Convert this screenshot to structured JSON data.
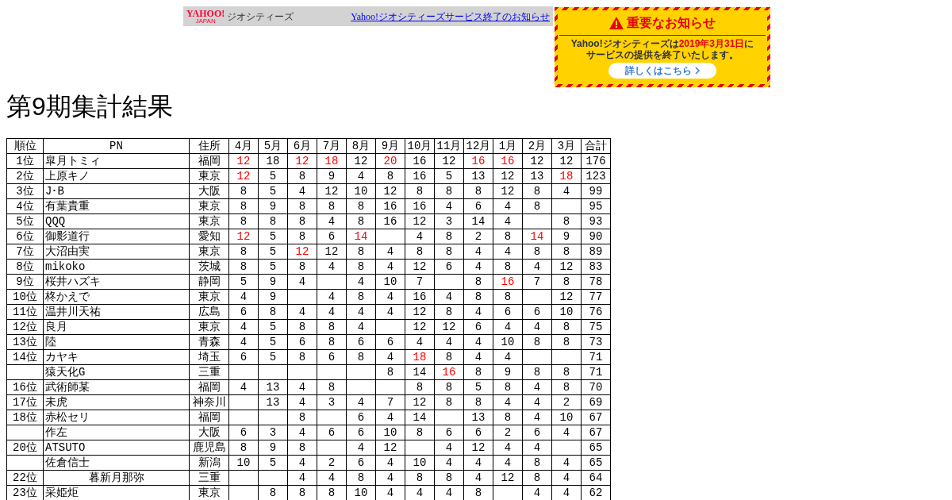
{
  "banner": {
    "logo": "YAHOO!",
    "logo_sub": "JAPAN",
    "service": "ジオシティーズ",
    "link": "Yahoo!ジオシティーズサービス終了のお知らせ"
  },
  "notice": {
    "title": "重要なお知らせ",
    "body_before": "Yahoo!ジオシティーズは",
    "date": "2019年3月31日",
    "body_after": "に",
    "line2": "サービスの提供を終了いたします。",
    "button": "詳しくはこちら"
  },
  "title": "第9期集計結果",
  "table": {
    "columns": [
      "順位",
      "PN",
      "住所",
      "4月",
      "5月",
      "6月",
      "7月",
      "8月",
      "9月",
      "10月",
      "11月",
      "12月",
      "1月",
      "2月",
      "3月",
      "合計"
    ],
    "rows": [
      {
        "rank": "1位",
        "name": "皐月トミィ",
        "centered": false,
        "place": "福岡",
        "months": {
          "apr": {
            "text": "12",
            "highlighted": true
          },
          "may": {
            "text": "18",
            "highlighted": false
          },
          "jun": {
            "text": "12",
            "highlighted": true
          },
          "jul": {
            "text": "18",
            "highlighted": true
          },
          "aug": {
            "text": "12",
            "highlighted": false
          },
          "sep": {
            "text": "20",
            "highlighted": true
          },
          "oct": {
            "text": "16",
            "highlighted": false
          },
          "nov": {
            "text": "12",
            "highlighted": false
          },
          "dec": {
            "text": "16",
            "highlighted": true
          },
          "jan": {
            "text": "16",
            "highlighted": true
          },
          "feb": {
            "text": "12",
            "highlighted": false
          },
          "mar": {
            "text": "12",
            "highlighted": false
          }
        },
        "total": "176"
      },
      {
        "rank": "2位",
        "name": "上原キノ",
        "centered": false,
        "place": "東京",
        "months": {
          "apr": {
            "text": "12",
            "highlighted": true
          },
          "may": {
            "text": "5",
            "highlighted": false
          },
          "jun": {
            "text": "8",
            "highlighted": false
          },
          "jul": {
            "text": "9",
            "highlighted": false
          },
          "aug": {
            "text": "4",
            "highlighted": false
          },
          "sep": {
            "text": "8",
            "highlighted": false
          },
          "oct": {
            "text": "16",
            "highlighted": false
          },
          "nov": {
            "text": "5",
            "highlighted": false
          },
          "dec": {
            "text": "13",
            "highlighted": false
          },
          "jan": {
            "text": "12",
            "highlighted": false
          },
          "feb": {
            "text": "13",
            "highlighted": false
          },
          "mar": {
            "text": "18",
            "highlighted": true
          }
        },
        "total": "123"
      },
      {
        "rank": "3位",
        "name": "J･B",
        "centered": false,
        "place": "大阪",
        "months": {
          "apr": {
            "text": "8",
            "highlighted": false
          },
          "may": {
            "text": "5",
            "highlighted": false
          },
          "jun": {
            "text": "4",
            "highlighted": false
          },
          "jul": {
            "text": "12",
            "highlighted": false
          },
          "aug": {
            "text": "10",
            "highlighted": false
          },
          "sep": {
            "text": "12",
            "highlighted": false
          },
          "oct": {
            "text": "8",
            "highlighted": false
          },
          "nov": {
            "text": "8",
            "highlighted": false
          },
          "dec": {
            "text": "8",
            "highlighted": false
          },
          "jan": {
            "text": "12",
            "highlighted": false
          },
          "feb": {
            "text": "8",
            "highlighted": false
          },
          "mar": {
            "text": "4",
            "highlighted": false
          }
        },
        "total": "99"
      },
      {
        "rank": "4位",
        "name": "有葉貴重",
        "centered": false,
        "place": "東京",
        "months": {
          "apr": {
            "text": "8",
            "highlighted": false
          },
          "may": {
            "text": "9",
            "highlighted": false
          },
          "jun": {
            "text": "8",
            "highlighted": false
          },
          "jul": {
            "text": "8",
            "highlighted": false
          },
          "aug": {
            "text": "8",
            "highlighted": false
          },
          "sep": {
            "text": "16",
            "highlighted": false
          },
          "oct": {
            "text": "16",
            "highlighted": false
          },
          "nov": {
            "text": "4",
            "highlighted": false
          },
          "dec": {
            "text": "6",
            "highlighted": false
          },
          "jan": {
            "text": "4",
            "highlighted": false
          },
          "feb": {
            "text": "8",
            "highlighted": false
          }
        },
        "total": "95"
      },
      {
        "rank": "5位",
        "name": "QQQ",
        "centered": false,
        "place": "東京",
        "months": {
          "apr": {
            "text": "8",
            "highlighted": false
          },
          "may": {
            "text": "8",
            "highlighted": false
          },
          "jun": {
            "text": "8",
            "highlighted": false
          },
          "jul": {
            "text": "4",
            "highlighted": false
          },
          "aug": {
            "text": "8",
            "highlighted": false
          },
          "sep": {
            "text": "16",
            "highlighted": false
          },
          "oct": {
            "text": "12",
            "highlighted": false
          },
          "nov": {
            "text": "3",
            "highlighted": false
          },
          "dec": {
            "text": "14",
            "highlighted": false
          },
          "jan": {
            "text": "4",
            "highlighted": false
          },
          "mar": {
            "text": "8",
            "highlighted": false
          }
        },
        "total": "93"
      },
      {
        "rank": "6位",
        "name": "御影道行",
        "centered": false,
        "place": "愛知",
        "months": {
          "apr": {
            "text": "12",
            "highlighted": true
          },
          "may": {
            "text": "5",
            "highlighted": false
          },
          "jun": {
            "text": "8",
            "highlighted": false
          },
          "jul": {
            "text": "6",
            "highlighted": false
          },
          "aug": {
            "text": "14",
            "highlighted": true
          },
          "oct": {
            "text": "4",
            "highlighted": false
          },
          "nov": {
            "text": "8",
            "highlighted": false
          },
          "dec": {
            "text": "2",
            "highlighted": false
          },
          "jan": {
            "text": "8",
            "highlighted": false
          },
          "feb": {
            "text": "14",
            "highlighted": true
          },
          "mar": {
            "text": "9",
            "highlighted": false
          }
        },
        "total": "90"
      },
      {
        "rank": "7位",
        "name": "大沼由実",
        "centered": false,
        "place": "東京",
        "months": {
          "apr": {
            "text": "8",
            "highlighted": false
          },
          "may": {
            "text": "5",
            "highlighted": false
          },
          "jun": {
            "text": "12",
            "highlighted": true
          },
          "jul": {
            "text": "12",
            "highlighted": false
          },
          "aug": {
            "text": "8",
            "highlighted": false
          },
          "sep": {
            "text": "4",
            "highlighted": false
          },
          "oct": {
            "text": "8",
            "highlighted": false
          },
          "nov": {
            "text": "8",
            "highlighted": false
          },
          "dec": {
            "text": "4",
            "highlighted": false
          },
          "jan": {
            "text": "4",
            "highlighted": false
          },
          "feb": {
            "text": "8",
            "highlighted": false
          },
          "mar": {
            "text": "8",
            "highlighted": false
          }
        },
        "total": "89"
      },
      {
        "rank": "8位",
        "name": "mikoko",
        "centered": false,
        "place": "茨城",
        "months": {
          "apr": {
            "text": "8",
            "highlighted": false
          },
          "may": {
            "text": "5",
            "highlighted": false
          },
          "jun": {
            "text": "8",
            "highlighted": false
          },
          "jul": {
            "text": "4",
            "highlighted": false
          },
          "aug": {
            "text": "8",
            "highlighted": false
          },
          "sep": {
            "text": "4",
            "highlighted": false
          },
          "oct": {
            "text": "12",
            "highlighted": false
          },
          "nov": {
            "text": "6",
            "highlighted": false
          },
          "dec": {
            "text": "4",
            "highlighted": false
          },
          "jan": {
            "text": "8",
            "highlighted": false
          },
          "feb": {
            "text": "4",
            "highlighted": false
          },
          "mar": {
            "text": "12",
            "highlighted": false
          }
        },
        "total": "83"
      },
      {
        "rank": "9位",
        "name": "桜井ハズキ",
        "centered": false,
        "place": "静岡",
        "months": {
          "apr": {
            "text": "5",
            "highlighted": false
          },
          "may": {
            "text": "9",
            "highlighted": false
          },
          "jun": {
            "text": "4",
            "highlighted": false
          },
          "aug": {
            "text": "4",
            "highlighted": false
          },
          "sep": {
            "text": "10",
            "highlighted": false
          },
          "oct": {
            "text": "7",
            "highlighted": false
          },
          "dec": {
            "text": "8",
            "highlighted": false
          },
          "jan": {
            "text": "16",
            "highlighted": true
          },
          "feb": {
            "text": "7",
            "highlighted": false
          },
          "mar": {
            "text": "8",
            "highlighted": false
          }
        },
        "total": "78"
      },
      {
        "rank": "10位",
        "name": "柊かえで",
        "centered": false,
        "place": "東京",
        "months": {
          "apr": {
            "text": "4",
            "highlighted": false
          },
          "may": {
            "text": "9",
            "highlighted": false
          },
          "jul": {
            "text": "4",
            "highlighted": false
          },
          "aug": {
            "text": "8",
            "highlighted": false
          },
          "sep": {
            "text": "4",
            "highlighted": false
          },
          "oct": {
            "text": "16",
            "highlighted": false
          },
          "nov": {
            "text": "4",
            "highlighted": false
          },
          "dec": {
            "text": "8",
            "highlighted": false
          },
          "jan": {
            "text": "8",
            "highlighted": false
          },
          "mar": {
            "text": "12",
            "highlighted": false
          }
        },
        "total": "77"
      },
      {
        "rank": "11位",
        "name": "温井川天祐",
        "centered": false,
        "place": "広島",
        "months": {
          "apr": {
            "text": "6",
            "highlighted": false
          },
          "may": {
            "text": "8",
            "highlighted": false
          },
          "jun": {
            "text": "4",
            "highlighted": false
          },
          "jul": {
            "text": "4",
            "highlighted": false
          },
          "aug": {
            "text": "4",
            "highlighted": false
          },
          "sep": {
            "text": "4",
            "highlighted": false
          },
          "oct": {
            "text": "12",
            "highlighted": false
          },
          "nov": {
            "text": "8",
            "highlighted": false
          },
          "dec": {
            "text": "4",
            "highlighted": false
          },
          "jan": {
            "text": "6",
            "highlighted": false
          },
          "feb": {
            "text": "6",
            "highlighted": false
          },
          "mar": {
            "text": "10",
            "highlighted": false
          }
        },
        "total": "76"
      },
      {
        "rank": "12位",
        "name": "良月",
        "centered": false,
        "place": "東京",
        "months": {
          "apr": {
            "text": "4",
            "highlighted": false
          },
          "may": {
            "text": "5",
            "highlighted": false
          },
          "jun": {
            "text": "8",
            "highlighted": false
          },
          "jul": {
            "text": "8",
            "highlighted": false
          },
          "aug": {
            "text": "4",
            "highlighted": false
          },
          "oct": {
            "text": "12",
            "highlighted": false
          },
          "nov": {
            "text": "12",
            "highlighted": false
          },
          "dec": {
            "text": "6",
            "highlighted": false
          },
          "jan": {
            "text": "4",
            "highlighted": false
          },
          "feb": {
            "text": "4",
            "highlighted": false
          },
          "mar": {
            "text": "8",
            "highlighted": false
          }
        },
        "total": "75"
      },
      {
        "rank": "13位",
        "name": "陸",
        "centered": false,
        "place": "青森",
        "months": {
          "apr": {
            "text": "4",
            "highlighted": false
          },
          "may": {
            "text": "5",
            "highlighted": false
          },
          "jun": {
            "text": "6",
            "highlighted": false
          },
          "jul": {
            "text": "8",
            "highlighted": false
          },
          "aug": {
            "text": "6",
            "highlighted": false
          },
          "sep": {
            "text": "6",
            "highlighted": false
          },
          "oct": {
            "text": "4",
            "highlighted": false
          },
          "nov": {
            "text": "4",
            "highlighted": false
          },
          "dec": {
            "text": "4",
            "highlighted": false
          },
          "jan": {
            "text": "10",
            "highlighted": false
          },
          "feb": {
            "text": "8",
            "highlighted": false
          },
          "mar": {
            "text": "8",
            "highlighted": false
          }
        },
        "total": "73"
      },
      {
        "rank": "14位",
        "name": "カヤキ",
        "centered": false,
        "place": "埼玉",
        "months": {
          "apr": {
            "text": "6",
            "highlighted": false
          },
          "may": {
            "text": "5",
            "highlighted": false
          },
          "jun": {
            "text": "8",
            "highlighted": false
          },
          "jul": {
            "text": "6",
            "highlighted": false
          },
          "aug": {
            "text": "8",
            "highlighted": false
          },
          "sep": {
            "text": "4",
            "highlighted": false
          },
          "oct": {
            "text": "18",
            "highlighted": true
          },
          "nov": {
            "text": "8",
            "highlighted": false
          },
          "dec": {
            "text": "4",
            "highlighted": false
          },
          "jan": {
            "text": "4",
            "highlighted": false
          }
        },
        "total": "71"
      },
      {
        "name": "猿天化G",
        "centered": false,
        "place": "三重",
        "months": {
          "sep": {
            "text": "8",
            "highlighted": false
          },
          "oct": {
            "text": "14",
            "highlighted": false
          },
          "nov": {
            "text": "16",
            "highlighted": true
          },
          "dec": {
            "text": "8",
            "highlighted": false
          },
          "jan": {
            "text": "9",
            "highlighted": false
          },
          "feb": {
            "text": "8",
            "highlighted": false
          },
          "mar": {
            "text": "8",
            "highlighted": false
          }
        },
        "total": "71"
      },
      {
        "rank": "16位",
        "name": "武術師某",
        "centered": false,
        "place": "福岡",
        "months": {
          "apr": {
            "text": "4",
            "highlighted": false
          },
          "may": {
            "text": "13",
            "highlighted": false
          },
          "jun": {
            "text": "4",
            "highlighted": false
          },
          "jul": {
            "text": "8",
            "highlighted": false
          },
          "oct": {
            "text": "8",
            "highlighted": false
          },
          "nov": {
            "text": "8",
            "highlighted": false
          },
          "dec": {
            "text": "5",
            "highlighted": false
          },
          "jan": {
            "text": "8",
            "highlighted": false
          },
          "feb": {
            "text": "4",
            "highlighted": false
          },
          "mar": {
            "text": "8",
            "highlighted": false
          }
        },
        "total": "70"
      },
      {
        "rank": "17位",
        "name": "未虎",
        "centered": false,
        "place": "神奈川",
        "months": {
          "may": {
            "text": "13",
            "highlighted": false
          },
          "jun": {
            "text": "4",
            "highlighted": false
          },
          "jul": {
            "text": "3",
            "highlighted": false
          },
          "aug": {
            "text": "4",
            "highlighted": false
          },
          "sep": {
            "text": "7",
            "highlighted": false
          },
          "oct": {
            "text": "12",
            "highlighted": false
          },
          "nov": {
            "text": "8",
            "highlighted": false
          },
          "dec": {
            "text": "8",
            "highlighted": false
          },
          "jan": {
            "text": "4",
            "highlighted": false
          },
          "feb": {
            "text": "4",
            "highlighted": false
          },
          "mar": {
            "text": "2",
            "highlighted": false
          }
        },
        "total": "69"
      },
      {
        "rank": "18位",
        "name": "赤松セリ",
        "centered": false,
        "place": "福岡",
        "months": {
          "jun": {
            "text": "8",
            "highlighted": false
          },
          "aug": {
            "text": "6",
            "highlighted": false
          },
          "sep": {
            "text": "4",
            "highlighted": false
          },
          "oct": {
            "text": "14",
            "highlighted": false
          },
          "dec": {
            "text": "13",
            "highlighted": false
          },
          "jan": {
            "text": "8",
            "highlighted": false
          },
          "feb": {
            "text": "4",
            "highlighted": false
          },
          "mar": {
            "text": "10",
            "highlighted": false
          }
        },
        "total": "67"
      },
      {
        "name": "作左",
        "centered": false,
        "place": "大阪",
        "months": {
          "apr": {
            "text": "6",
            "highlighted": false
          },
          "may": {
            "text": "3",
            "highlighted": false
          },
          "jun": {
            "text": "4",
            "highlighted": false
          },
          "jul": {
            "text": "6",
            "highlighted": false
          },
          "aug": {
            "text": "6",
            "highlighted": false
          },
          "sep": {
            "text": "10",
            "highlighted": false
          },
          "oct": {
            "text": "8",
            "highlighted": false
          },
          "nov": {
            "text": "6",
            "highlighted": false
          },
          "dec": {
            "text": "6",
            "highlighted": false
          },
          "jan": {
            "text": "2",
            "highlighted": false
          },
          "feb": {
            "text": "6",
            "highlighted": false
          },
          "mar": {
            "text": "4",
            "highlighted": false
          }
        },
        "total": "67"
      },
      {
        "rank": "20位",
        "name": "ATSUTO",
        "centered": false,
        "place": "鹿児島",
        "months": {
          "apr": {
            "text": "8",
            "highlighted": false
          },
          "may": {
            "text": "9",
            "highlighted": false
          },
          "jun": {
            "text": "8",
            "highlighted": false
          },
          "aug": {
            "text": "4",
            "highlighted": false
          },
          "sep": {
            "text": "12",
            "highlighted": false
          },
          "nov": {
            "text": "4",
            "highlighted": false
          },
          "dec": {
            "text": "12",
            "highlighted": false
          },
          "jan": {
            "text": "4",
            "highlighted": false
          },
          "feb": {
            "text": "4",
            "highlighted": false
          }
        },
        "total": "65"
      },
      {
        "name": "佐倉信士",
        "centered": false,
        "place": "新潟",
        "months": {
          "apr": {
            "text": "10",
            "highlighted": false
          },
          "may": {
            "text": "5",
            "highlighted": false
          },
          "jun": {
            "text": "4",
            "highlighted": false
          },
          "jul": {
            "text": "2",
            "highlighted": false
          },
          "aug": {
            "text": "6",
            "highlighted": false
          },
          "sep": {
            "text": "4",
            "highlighted": false
          },
          "oct": {
            "text": "10",
            "highlighted": false
          },
          "nov": {
            "text": "4",
            "highlighted": false
          },
          "dec": {
            "text": "4",
            "highlighted": false
          },
          "jan": {
            "text": "4",
            "highlighted": false
          },
          "feb": {
            "text": "8",
            "highlighted": false
          },
          "mar": {
            "text": "4",
            "highlighted": false
          }
        },
        "total": "65"
      },
      {
        "rank": "22位",
        "name": "暮新月那弥",
        "centered": true,
        "place": "三重",
        "months": {
          "jun": {
            "text": "4",
            "highlighted": false
          },
          "jul": {
            "text": "4",
            "highlighted": false
          },
          "aug": {
            "text": "8",
            "highlighted": false
          },
          "sep": {
            "text": "4",
            "highlighted": false
          },
          "oct": {
            "text": "8",
            "highlighted": false
          },
          "nov": {
            "text": "8",
            "highlighted": false
          },
          "dec": {
            "text": "4",
            "highlighted": false
          },
          "jan": {
            "text": "12",
            "highlighted": false
          },
          "feb": {
            "text": "8",
            "highlighted": false
          },
          "mar": {
            "text": "4",
            "highlighted": false
          }
        },
        "total": "64"
      },
      {
        "rank": "23位",
        "name": "采姫炬",
        "centered": false,
        "place": "東京",
        "months": {
          "may": {
            "text": "8",
            "highlighted": false
          },
          "jun": {
            "text": "8",
            "highlighted": false
          },
          "jul": {
            "text": "8",
            "highlighted": false
          },
          "aug": {
            "text": "10",
            "highlighted": false
          },
          "sep": {
            "text": "4",
            "highlighted": false
          },
          "oct": {
            "text": "4",
            "highlighted": false
          },
          "nov": {
            "text": "4",
            "highlighted": false
          },
          "dec": {
            "text": "8",
            "highlighted": false
          },
          "feb": {
            "text": "4",
            "highlighted": false
          },
          "mar": {
            "text": "4",
            "highlighted": false
          }
        },
        "total": "62"
      }
    ]
  }
}
